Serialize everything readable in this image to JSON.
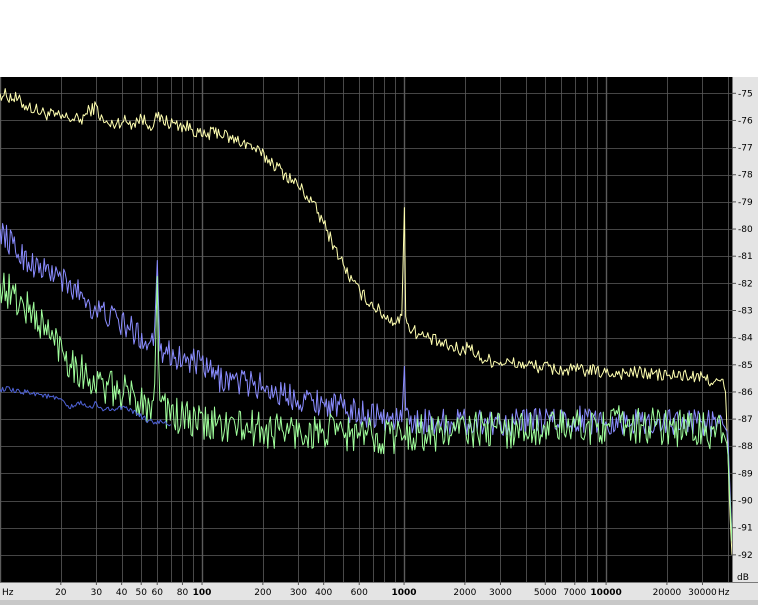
{
  "chart_data": {
    "type": "line",
    "title": "",
    "xlabel": "",
    "ylabel": "",
    "x_unit": "Hz",
    "y_unit": "dB",
    "x_scale": "log",
    "xlim": [
      10,
      42000
    ],
    "ylim": [
      -93,
      -74.4
    ],
    "grid": true,
    "background": "#000000",
    "grid_color": "#5c5c5c",
    "x_ticks": [
      {
        "value": 20,
        "label": "20",
        "bold": false
      },
      {
        "value": 30,
        "label": "30",
        "bold": false
      },
      {
        "value": 40,
        "label": "40",
        "bold": false
      },
      {
        "value": 50,
        "label": "50",
        "bold": false
      },
      {
        "value": 60,
        "label": "60",
        "bold": false
      },
      {
        "value": 80,
        "label": "80",
        "bold": false
      },
      {
        "value": 100,
        "label": "100",
        "bold": true
      },
      {
        "value": 200,
        "label": "200",
        "bold": false
      },
      {
        "value": 300,
        "label": "300",
        "bold": false
      },
      {
        "value": 400,
        "label": "400",
        "bold": false
      },
      {
        "value": 600,
        "label": "600",
        "bold": false
      },
      {
        "value": 1000,
        "label": "1000",
        "bold": true
      },
      {
        "value": 2000,
        "label": "2000",
        "bold": false
      },
      {
        "value": 3000,
        "label": "3000",
        "bold": false
      },
      {
        "value": 5000,
        "label": "5000",
        "bold": false
      },
      {
        "value": 7000,
        "label": "7000",
        "bold": false
      },
      {
        "value": 10000,
        "label": "10000",
        "bold": true
      },
      {
        "value": 20000,
        "label": "20000",
        "bold": false
      },
      {
        "value": 30000,
        "label": "30000",
        "bold": false
      }
    ],
    "y_ticks": [
      {
        "value": -75,
        "label": "-75"
      },
      {
        "value": -76,
        "label": "-76"
      },
      {
        "value": -77,
        "label": "-77"
      },
      {
        "value": -78,
        "label": "-78"
      },
      {
        "value": -79,
        "label": "-79"
      },
      {
        "value": -80,
        "label": "-80"
      },
      {
        "value": -81,
        "label": "-81"
      },
      {
        "value": -82,
        "label": "-82"
      },
      {
        "value": -83,
        "label": "-83"
      },
      {
        "value": -84,
        "label": "-84"
      },
      {
        "value": -85,
        "label": "-85"
      },
      {
        "value": -86,
        "label": "-86"
      },
      {
        "value": -87,
        "label": "-87"
      },
      {
        "value": -88,
        "label": "-88"
      },
      {
        "value": -89,
        "label": "-89"
      },
      {
        "value": -90,
        "label": "-90"
      },
      {
        "value": -91,
        "label": "-91"
      },
      {
        "value": -92,
        "label": "-92"
      }
    ],
    "series": [
      {
        "color": "#ffffb0",
        "noise": 0.25,
        "x": [
          10,
          12,
          13,
          14,
          15,
          16,
          18,
          20,
          22,
          25,
          28,
          30,
          32,
          35,
          40,
          45,
          50,
          55,
          60,
          70,
          80,
          90,
          100,
          120,
          140,
          160,
          180,
          200,
          220,
          250,
          300,
          350,
          400,
          450,
          500,
          550,
          600,
          700,
          800,
          900,
          980,
          1000,
          1020,
          1100,
          1200,
          1400,
          1600,
          1800,
          2000,
          2100,
          2200,
          2500,
          3000,
          4000,
          5000,
          6000,
          8000,
          10000,
          12000,
          15000,
          20000,
          25000,
          30000,
          35000,
          38000,
          39000,
          40000,
          41000,
          42000
        ],
        "y": [
          -75.0,
          -75.2,
          -75.4,
          -75.5,
          -75.6,
          -75.7,
          -75.8,
          -75.9,
          -75.9,
          -76.0,
          -75.6,
          -75.5,
          -76.0,
          -76.2,
          -76.0,
          -76.1,
          -75.9,
          -76.2,
          -75.9,
          -76.1,
          -76.2,
          -76.3,
          -76.6,
          -76.4,
          -76.7,
          -76.8,
          -77.0,
          -77.3,
          -77.5,
          -77.9,
          -78.4,
          -79.0,
          -79.8,
          -80.6,
          -81.3,
          -81.9,
          -82.3,
          -82.8,
          -83.2,
          -83.4,
          -83.3,
          -78.1,
          -83.5,
          -83.7,
          -83.9,
          -84.1,
          -84.3,
          -84.4,
          -84.5,
          -84.1,
          -84.6,
          -84.8,
          -84.9,
          -85.0,
          -85.1,
          -85.2,
          -85.2,
          -85.3,
          -85.3,
          -85.3,
          -85.4,
          -85.4,
          -85.5,
          -85.6,
          -85.7,
          -86.0,
          -88.0,
          -90.5,
          -92.0
        ]
      },
      {
        "color": "#8a8cff",
        "noise": 0.5,
        "x": [
          10,
          11,
          12,
          14,
          16,
          18,
          20,
          22,
          25,
          28,
          30,
          35,
          40,
          45,
          50,
          55,
          58,
          60,
          62,
          65,
          70,
          80,
          90,
          100,
          110,
          120,
          150,
          200,
          250,
          300,
          400,
          500,
          600,
          700,
          800,
          900,
          980,
          1000,
          1020,
          1200,
          1500,
          2000,
          3000,
          5000,
          7000,
          10000,
          15000,
          20000,
          30000,
          38000,
          40000,
          41000,
          42000
        ],
        "y": [
          -80.0,
          -80.4,
          -80.8,
          -81.2,
          -81.5,
          -81.6,
          -81.8,
          -82.2,
          -82.3,
          -82.8,
          -83.0,
          -83.2,
          -83.5,
          -83.7,
          -84.0,
          -84.2,
          -84.0,
          -80.9,
          -84.3,
          -84.5,
          -84.6,
          -84.8,
          -84.9,
          -85.0,
          -85.3,
          -85.5,
          -85.6,
          -85.8,
          -86.1,
          -86.2,
          -86.4,
          -86.6,
          -86.8,
          -86.8,
          -87.0,
          -87.0,
          -86.9,
          -85.0,
          -87.0,
          -87.1,
          -87.1,
          -87.1,
          -87.1,
          -87.1,
          -87.0,
          -87.1,
          -87.1,
          -87.1,
          -87.1,
          -87.2,
          -87.5,
          -89.5,
          -91.5
        ]
      },
      {
        "color": "#a0ff9c",
        "noise": 0.7,
        "x": [
          10,
          11,
          12,
          14,
          16,
          18,
          20,
          22,
          25,
          28,
          30,
          35,
          40,
          45,
          50,
          55,
          58,
          60,
          62,
          65,
          70,
          80,
          90,
          100,
          120,
          150,
          200,
          250,
          300,
          400,
          500,
          600,
          700,
          800,
          1000,
          1200,
          1500,
          2000,
          3000,
          5000,
          7000,
          10000,
          15000,
          20000,
          30000,
          38000,
          40000,
          41000,
          42000
        ],
        "y": [
          -82.0,
          -82.3,
          -82.6,
          -83.0,
          -83.5,
          -84.0,
          -84.3,
          -84.8,
          -85.2,
          -85.5,
          -85.7,
          -85.9,
          -86.0,
          -86.2,
          -86.3,
          -86.5,
          -86.0,
          -82.0,
          -86.4,
          -86.6,
          -86.8,
          -87.0,
          -87.1,
          -87.2,
          -87.2,
          -87.3,
          -87.4,
          -87.4,
          -87.5,
          -87.5,
          -87.5,
          -87.6,
          -87.6,
          -87.6,
          -87.6,
          -87.5,
          -87.5,
          -87.4,
          -87.4,
          -87.3,
          -87.3,
          -87.2,
          -87.2,
          -87.3,
          -87.4,
          -87.5,
          -88.0,
          -90.0,
          -91.5
        ]
      },
      {
        "color": "#4f62d6",
        "noise": 0.1,
        "x": [
          10,
          11,
          12,
          14,
          16,
          18,
          20,
          22,
          25,
          28,
          30,
          33,
          35,
          40,
          45,
          50,
          55,
          60,
          70
        ],
        "y": [
          -85.9,
          -85.9,
          -86.0,
          -86.0,
          -86.1,
          -86.2,
          -86.3,
          -86.6,
          -86.4,
          -86.6,
          -86.4,
          -86.7,
          -86.6,
          -86.6,
          -86.7,
          -86.9,
          -87.1,
          -87.1,
          -87.2
        ]
      }
    ]
  }
}
